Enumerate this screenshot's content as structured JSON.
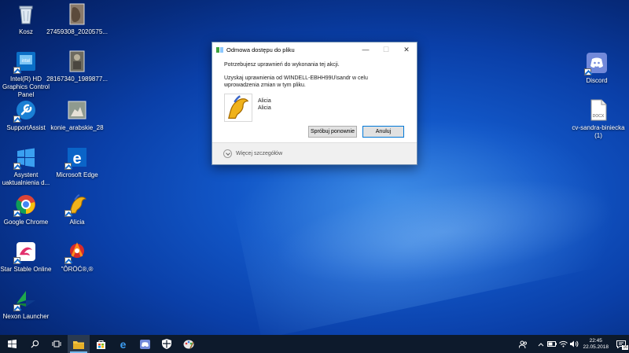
{
  "desktop": {
    "icons": [
      {
        "name": "recycle-bin",
        "label": "Kosz"
      },
      {
        "name": "photo-1",
        "label": "27459308_2020575..."
      },
      {
        "name": "intel-graphics",
        "label": "Intel(R) HD Graphics Control Panel"
      },
      {
        "name": "photo-2",
        "label": "28167340_1989877..."
      },
      {
        "name": "supportassist",
        "label": "SupportAssist"
      },
      {
        "name": "konie",
        "label": "konie_arabskie_28"
      },
      {
        "name": "update-assistant",
        "label": "Asystent uaktualnienia d..."
      },
      {
        "name": "edge",
        "label": "Microsoft Edge"
      },
      {
        "name": "chrome",
        "label": "Google Chrome"
      },
      {
        "name": "alicia",
        "label": "Alicia"
      },
      {
        "name": "star-stable",
        "label": "Star Stable Online"
      },
      {
        "name": "garbled",
        "label": "\"ÔRÖĆ®,®"
      },
      {
        "name": "nexon",
        "label": "Nexon Launcher"
      },
      {
        "name": "discord",
        "label": "Discord"
      },
      {
        "name": "cv",
        "label": "cv-sandra-biniecka (1)"
      }
    ],
    "docx_badge": "DOCX"
  },
  "dialog": {
    "title": "Odmowa dostępu do pliku",
    "line1": "Potrzebujesz uprawnień do wykonania tej akcji.",
    "line2": "Uzyskaj uprawnienia od WINDELL-EBHH99U\\sandr w celu wprowadzenia zmian w tym pliku.",
    "file_name1": "Alicia",
    "file_name2": "Alicia",
    "retry_label": "Spróbuj ponownie",
    "cancel_label": "Anuluj",
    "details_label": "Więcej szczegółów"
  },
  "taskbar": {
    "time": "22:45",
    "date": "22.05.2018",
    "notification_count": "16"
  },
  "colors": {
    "accent": "#0078d7",
    "taskbar": "#0d1a2c"
  }
}
